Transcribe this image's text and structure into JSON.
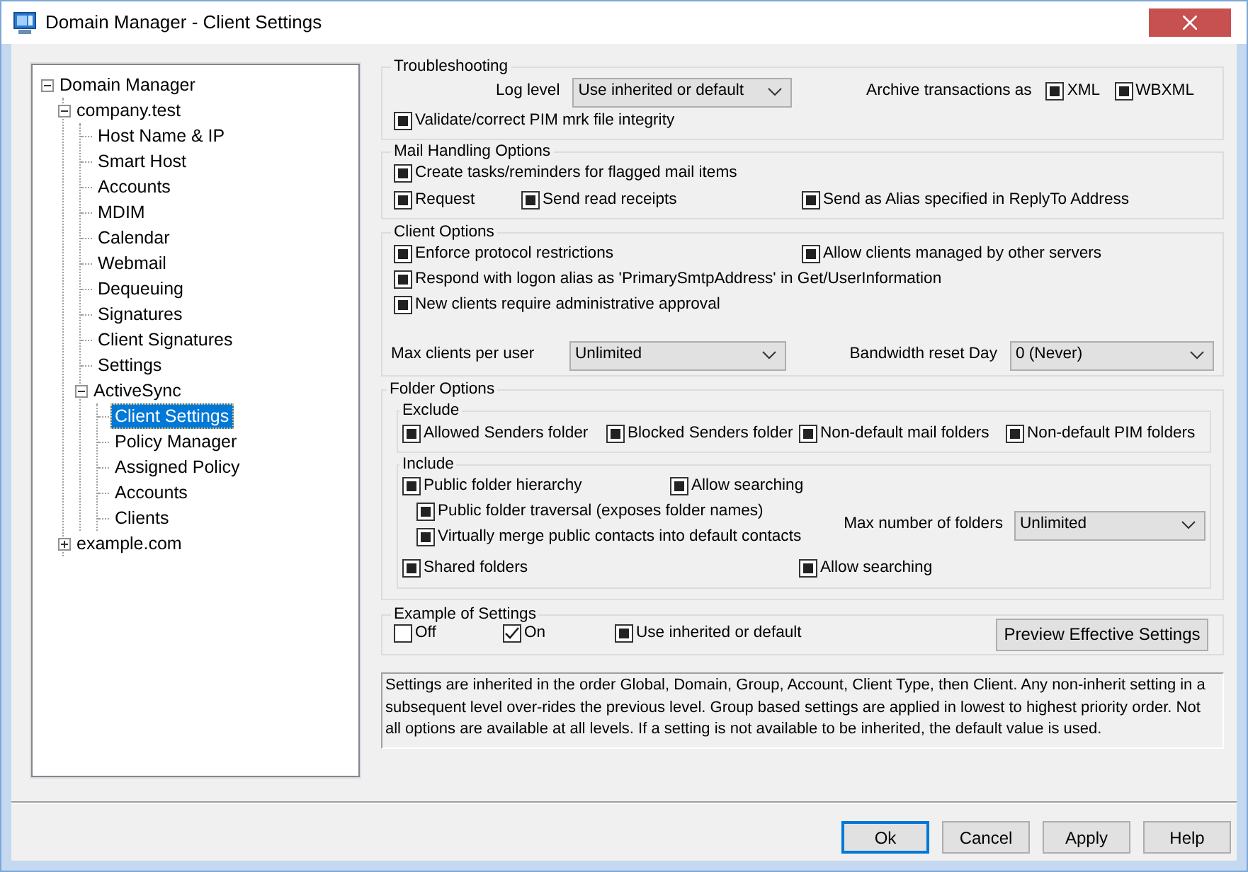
{
  "window": {
    "title": "Domain Manager - Client Settings"
  },
  "tree": [
    {
      "label": "Domain Manager",
      "expanded": true,
      "selected": false,
      "children": [
        {
          "label": "company.test",
          "expanded": true,
          "selected": false,
          "children": [
            {
              "label": "Host Name & IP",
              "selected": false
            },
            {
              "label": "Smart Host",
              "selected": false
            },
            {
              "label": "Accounts",
              "selected": false
            },
            {
              "label": "MDIM",
              "selected": false
            },
            {
              "label": "Calendar",
              "selected": false
            },
            {
              "label": "Webmail",
              "selected": false
            },
            {
              "label": "Dequeuing",
              "selected": false
            },
            {
              "label": "Signatures",
              "selected": false
            },
            {
              "label": "Client Signatures",
              "selected": false
            },
            {
              "label": "Settings",
              "selected": false
            },
            {
              "label": "ActiveSync",
              "expanded": true,
              "selected": false,
              "children": [
                {
                  "label": "Client Settings",
                  "selected": true
                },
                {
                  "label": "Policy Manager",
                  "selected": false
                },
                {
                  "label": "Assigned Policy",
                  "selected": false
                },
                {
                  "label": "Accounts",
                  "selected": false
                },
                {
                  "label": "Clients",
                  "selected": false
                }
              ]
            }
          ]
        },
        {
          "label": "example.com",
          "expanded": false,
          "selected": false
        }
      ]
    }
  ],
  "troubleshooting": {
    "title": "Troubleshooting",
    "log_level": {
      "label": "Log level",
      "value": "Use inherited or default"
    },
    "archive_label": "Archive transactions as",
    "archive_options": [
      {
        "label": "XML",
        "checked": false,
        "indeterminate": true
      },
      {
        "label": "WBXML",
        "checked": false,
        "indeterminate": true
      }
    ],
    "validate": {
      "label": "Validate/correct PIM mrk file integrity",
      "checked": false,
      "indeterminate": true
    }
  },
  "mail_handling": {
    "title": "Mail Handling Options",
    "options": [
      {
        "label": "Create tasks/reminders for flagged mail items",
        "checked": false,
        "indeterminate": true
      },
      {
        "label": "Request",
        "checked": false,
        "indeterminate": true
      },
      {
        "label": "Send read receipts",
        "checked": false,
        "indeterminate": true
      },
      {
        "label": "Send as Alias specified in ReplyTo Address",
        "checked": false,
        "indeterminate": true
      }
    ]
  },
  "client_options": {
    "title": "Client Options",
    "options": [
      {
        "label": "Enforce protocol restrictions",
        "checked": false,
        "indeterminate": true
      },
      {
        "label": "Allow clients managed by other servers",
        "checked": false,
        "indeterminate": true
      },
      {
        "label": "Respond with logon alias as 'PrimarySmtpAddress' in Get/UserInformation",
        "checked": false,
        "indeterminate": true
      },
      {
        "label": "New clients require administrative approval",
        "checked": false,
        "indeterminate": true
      }
    ],
    "max_clients": {
      "label": "Max clients per user",
      "value": "Unlimited"
    },
    "bandwidth_reset": {
      "label": "Bandwidth reset Day",
      "value": "0 (Never)"
    }
  },
  "folder_options": {
    "title": "Folder Options",
    "exclude": {
      "title": "Exclude",
      "options": [
        {
          "label": "Allowed Senders folder",
          "checked": false,
          "indeterminate": true
        },
        {
          "label": "Blocked Senders folder",
          "checked": false,
          "indeterminate": true
        },
        {
          "label": "Non-default mail folders",
          "checked": false,
          "indeterminate": true
        },
        {
          "label": "Non-default PIM folders",
          "checked": false,
          "indeterminate": true
        }
      ]
    },
    "include": {
      "title": "Include",
      "options": [
        {
          "label": "Public folder hierarchy",
          "checked": false,
          "indeterminate": true
        },
        {
          "label": "Allow searching",
          "checked": false,
          "indeterminate": true
        },
        {
          "label": "Public folder traversal (exposes folder names)",
          "checked": false,
          "indeterminate": true
        },
        {
          "label": "Virtually merge public contacts into default contacts",
          "checked": false,
          "indeterminate": true
        },
        {
          "label": "Shared folders",
          "checked": false,
          "indeterminate": true
        },
        {
          "label": "Allow searching",
          "checked": false,
          "indeterminate": true
        }
      ],
      "max_folders": {
        "label": "Max number of folders",
        "value": "Unlimited"
      }
    }
  },
  "example": {
    "title": "Example of Settings",
    "options": [
      {
        "label": "Off",
        "checked": false,
        "indeterminate": false
      },
      {
        "label": "On",
        "checked": true,
        "indeterminate": false
      },
      {
        "label": "Use inherited or default",
        "checked": false,
        "indeterminate": true
      }
    ],
    "preview_button": "Preview Effective Settings"
  },
  "info_text": "Settings are inherited in the order Global, Domain, Group, Account, Client Type, then Client. Any non-inherit setting in a subsequent level over-rides the previous level. Group based settings are applied in lowest to highest priority order. Not all options are available at all levels. If a setting is not available to be inherited, the default value is used.",
  "buttons": [
    {
      "label": "Ok",
      "default": true
    },
    {
      "label": "Cancel",
      "default": false
    },
    {
      "label": "Apply",
      "default": false
    },
    {
      "label": "Help",
      "default": false
    }
  ]
}
